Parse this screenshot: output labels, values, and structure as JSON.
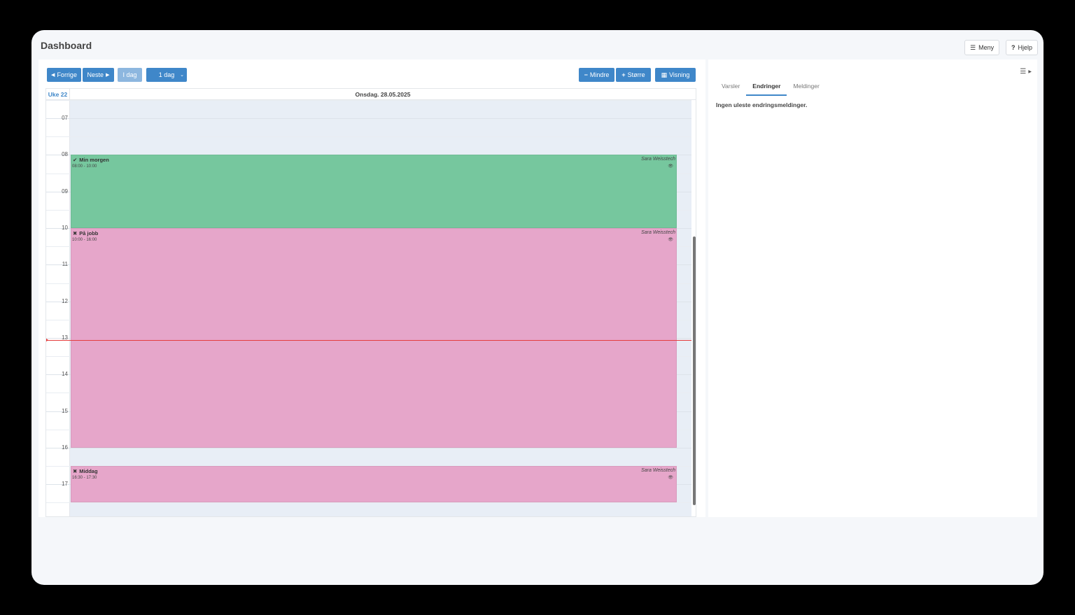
{
  "page": {
    "title": "Dashboard"
  },
  "header_buttons": {
    "menu": "Meny",
    "help": "Hjelp"
  },
  "toolbar": {
    "prev": "Forrige",
    "next": "Neste",
    "today": "I dag",
    "range": "1 dag",
    "smaller": "Mindre",
    "larger": "Større",
    "view": "Visning"
  },
  "calendar": {
    "week_label": "Uke 22",
    "day_header": "Onsdag. 28.05.2025",
    "hours": [
      "07",
      "08",
      "09",
      "10",
      "11",
      "12",
      "13",
      "14",
      "15",
      "16",
      "17"
    ],
    "current_time_hour": 13.05,
    "events": [
      {
        "title": "Min morgen",
        "time": "08:00 - 10:00",
        "owner": "Sara Weisstech",
        "status": "check",
        "color": "#76c79e",
        "start": 8.0,
        "end": 10.0
      },
      {
        "title": "På jobb",
        "time": "10:00 - 16:00",
        "owner": "Sara Weisstech",
        "status": "cross",
        "color": "#e6a6ca",
        "start": 10.0,
        "end": 16.0
      },
      {
        "title": "Middag",
        "time": "16:30 - 17:30",
        "owner": "Sara Weisstech",
        "status": "cross",
        "color": "#e6a6ca",
        "start": 16.5,
        "end": 17.5
      }
    ]
  },
  "side_panel": {
    "tabs": [
      "Varsler",
      "Endringer",
      "Meldinger"
    ],
    "active_tab": "Endringer",
    "message": "Ingen uleste endringsmeldinger."
  }
}
